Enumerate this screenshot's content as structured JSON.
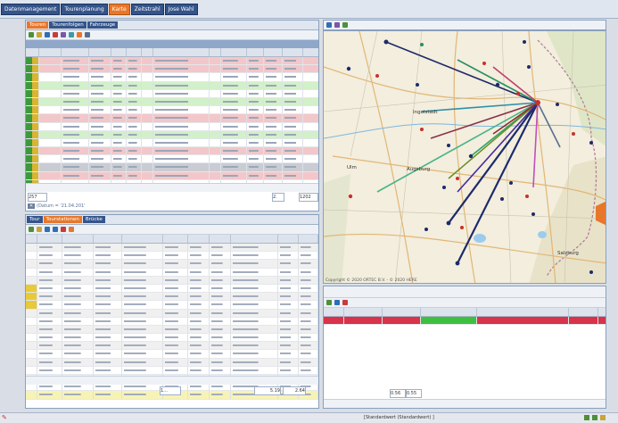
{
  "menu": {
    "tabs": [
      {
        "label": "Datenmanagement",
        "active": false
      },
      {
        "label": "Tourenplanung",
        "active": false
      },
      {
        "label": "Karte",
        "active": true
      },
      {
        "label": "Zeitstrahl",
        "active": false
      },
      {
        "label": "Jose Wahl",
        "active": false
      }
    ]
  },
  "top_left": {
    "tabs": [
      {
        "label": "Touren",
        "active": true
      },
      {
        "label": "Tourenfolgen",
        "active": false
      },
      {
        "label": "Fahrzeuge",
        "active": false
      }
    ],
    "row_count": "257",
    "page_field": "2.",
    "total_field": "1202",
    "filter_text": "(Datum = '21.04.201'"
  },
  "bottom_left": {
    "tabs": [
      {
        "label": "Tour",
        "active": false
      },
      {
        "label": "Tourstationen",
        "active": true
      },
      {
        "label": "Brücke",
        "active": false
      }
    ],
    "footer_dots": "1...",
    "value_a": "5.19",
    "value_b": "2.64"
  },
  "map": {
    "labels": {
      "ingolstadt": "Ingolstadt",
      "ulm": "Ulm",
      "augsburg": "Augsburg",
      "salzburg": "Salzburg"
    },
    "copyright": "Copyright © 2020 ORTEC B.V. - © 2020 HERE"
  },
  "bottom_right": {
    "value_a": "0.56",
    "value_b": "0.55"
  },
  "statusbar": {
    "text": "[Standardwert (Standardwert) ]"
  },
  "colors": {
    "accent": "#e8772b",
    "tab_blue": "#34548a",
    "row_red": "#f3c7c9",
    "row_green": "#d2f0c9",
    "row_yellow": "#f7f3b5",
    "highlight_red": "#d8334a"
  }
}
